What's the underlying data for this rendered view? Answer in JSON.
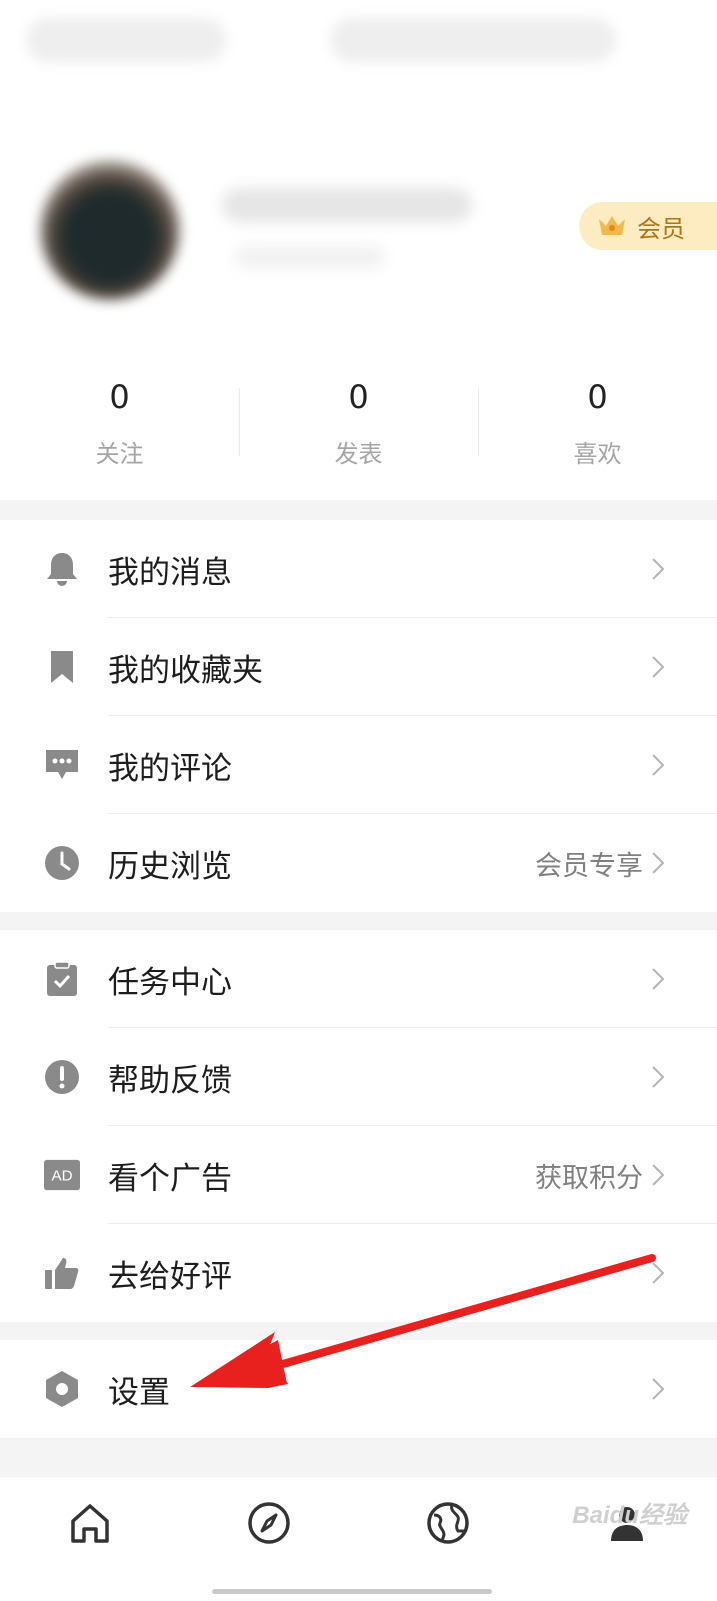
{
  "profile": {
    "vip_label": "会员"
  },
  "stats": [
    {
      "value": "0",
      "label": "关注"
    },
    {
      "value": "0",
      "label": "发表"
    },
    {
      "value": "0",
      "label": "喜欢"
    }
  ],
  "menu": {
    "group1": [
      {
        "label": "我的消息",
        "icon": "bell-icon",
        "aside": ""
      },
      {
        "label": "我的收藏夹",
        "icon": "bookmark-icon",
        "aside": ""
      },
      {
        "label": "我的评论",
        "icon": "comment-icon",
        "aside": ""
      },
      {
        "label": "历史浏览",
        "icon": "clock-icon",
        "aside": "会员专享"
      }
    ],
    "group2": [
      {
        "label": "任务中心",
        "icon": "clipboard-check-icon",
        "aside": ""
      },
      {
        "label": "帮助反馈",
        "icon": "exclamation-icon",
        "aside": ""
      },
      {
        "label": "看个广告",
        "icon": "ad-icon",
        "aside": "获取积分",
        "icon_text": "AD"
      },
      {
        "label": "去给好评",
        "icon": "thumbs-up-icon",
        "aside": ""
      }
    ],
    "group3": [
      {
        "label": "设置",
        "icon": "settings-hexagon-icon",
        "aside": ""
      }
    ]
  },
  "tabbar": [
    "home-icon",
    "compass-icon",
    "globe-icon",
    "profile-icon"
  ],
  "watermark": "Baidu经验",
  "colors": {
    "icon_gray": "#8a8a8a",
    "vip_bg": "#fdebc2",
    "vip_text": "#b07415",
    "annotation_arrow": "#e8201e"
  }
}
